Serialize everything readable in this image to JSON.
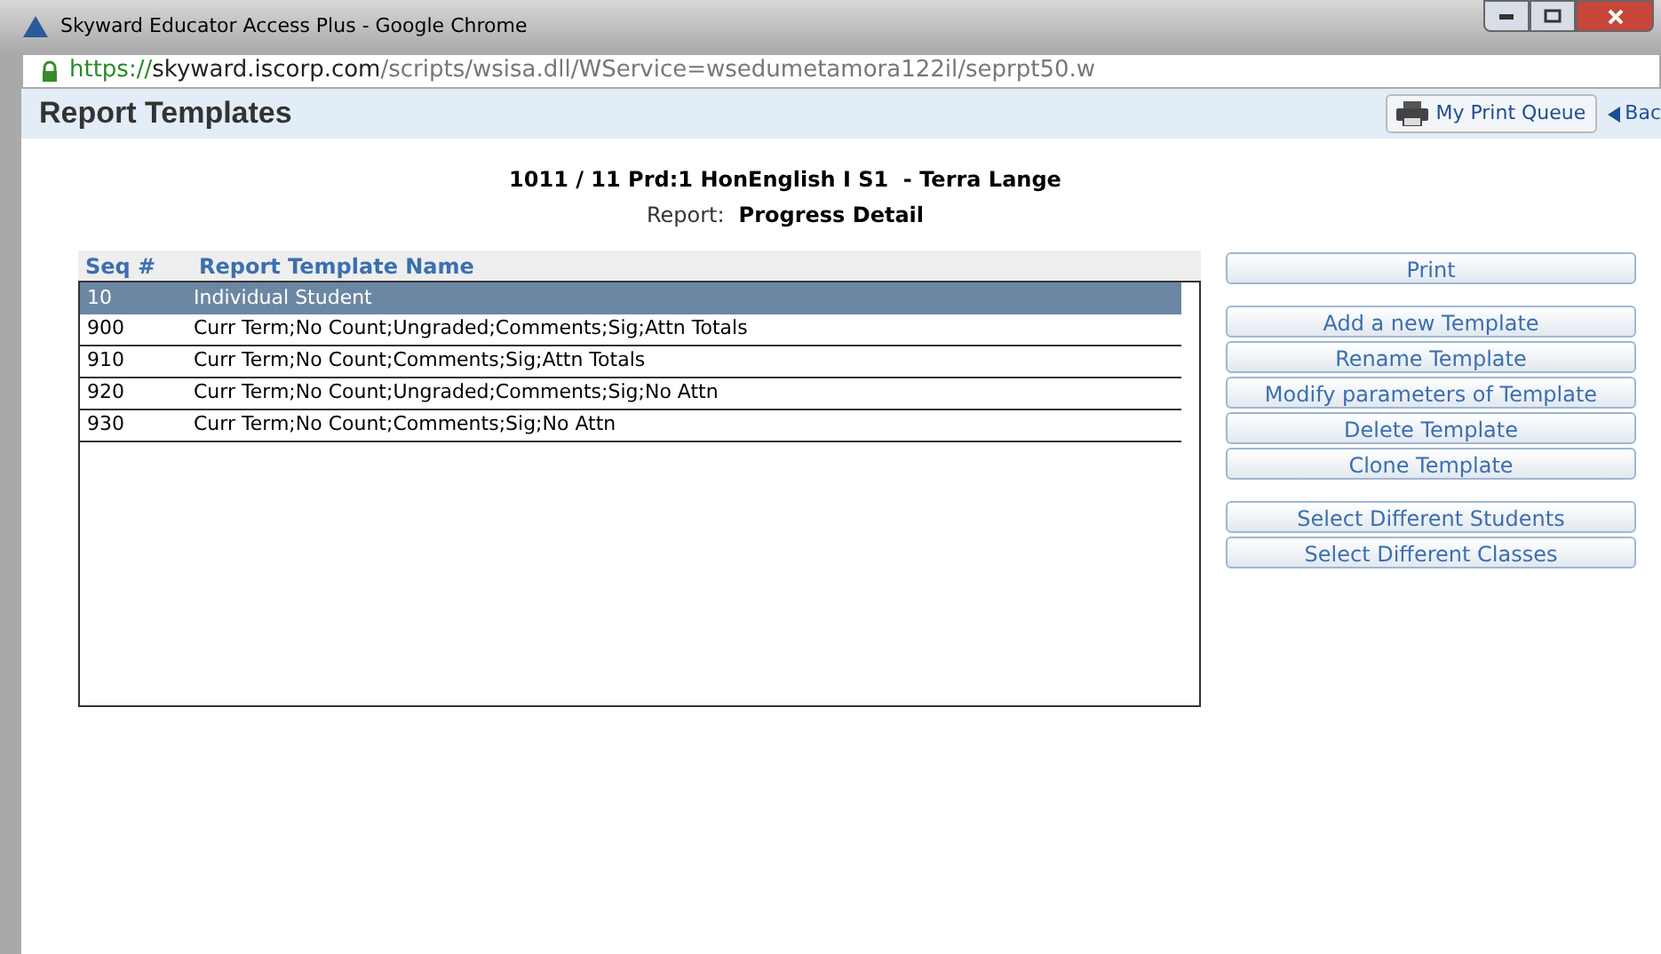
{
  "window": {
    "title": "Skyward Educator Access Plus - Google Chrome"
  },
  "address_bar": {
    "scheme": "https://",
    "host": "skyward.iscorp.com",
    "path": "/scripts/wsisa.dll/WService=wsedumetamora122il/seprpt50.w"
  },
  "page_header": {
    "title": "Report Templates",
    "print_queue": "My Print Queue",
    "back": "Bac"
  },
  "class_title": "1011 / 11 Prd:1 HonEnglish I S1  - Terra Lange",
  "report": {
    "label": "Report:",
    "value": "Progress Detail"
  },
  "table": {
    "columns": [
      "Seq #",
      "Report Template Name"
    ],
    "rows": [
      {
        "seq": "10",
        "name": "Individual Student",
        "selected": true
      },
      {
        "seq": "900",
        "name": "Curr Term;No Count;Ungraded;Comments;Sig;Attn Totals",
        "selected": false
      },
      {
        "seq": "910",
        "name": "Curr Term;No Count;Comments;Sig;Attn Totals",
        "selected": false
      },
      {
        "seq": "920",
        "name": "Curr Term;No Count;Ungraded;Comments;Sig;No Attn",
        "selected": false
      },
      {
        "seq": "930",
        "name": "Curr Term;No Count;Comments;Sig;No Attn",
        "selected": false
      }
    ]
  },
  "button_groups": [
    [
      "Print"
    ],
    [
      "Add a new Template",
      "Rename Template",
      "Modify parameters of Template",
      "Delete Template",
      "Clone Template"
    ],
    [
      "Select Different Students",
      "Select Different Classes"
    ]
  ]
}
